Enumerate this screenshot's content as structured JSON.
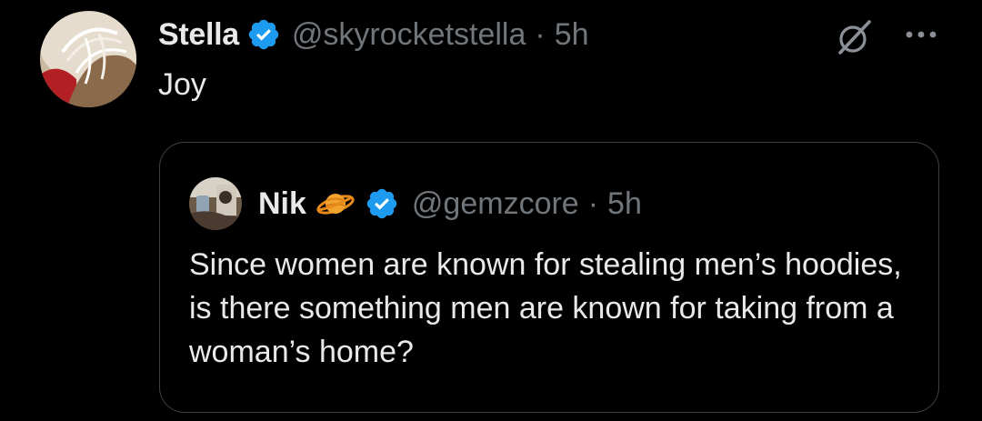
{
  "post": {
    "author": {
      "display_name": "Stella",
      "handle": "@skyrocketstella",
      "verified": true,
      "avatar_icon": "avatar-photo"
    },
    "separator": "·",
    "time": "5h",
    "text": "Joy",
    "actions": {
      "grok_icon": "grok-icon",
      "more_icon": "more-icon"
    }
  },
  "quoted_post": {
    "author": {
      "display_name": "Nik",
      "emoji_icon": "ringed-planet",
      "handle": "@gemzcore",
      "verified": true,
      "avatar_icon": "avatar-photo"
    },
    "separator": "·",
    "time": "5h",
    "text": "Since women are known for stealing men’s hoodies, is there something men are known for taking from a woman’s home?"
  },
  "colors": {
    "background": "#000000",
    "primary_text": "#e7e9ea",
    "secondary_text": "#71767b",
    "verified_blue": "#1d9bf0",
    "border": "#3e4144"
  }
}
